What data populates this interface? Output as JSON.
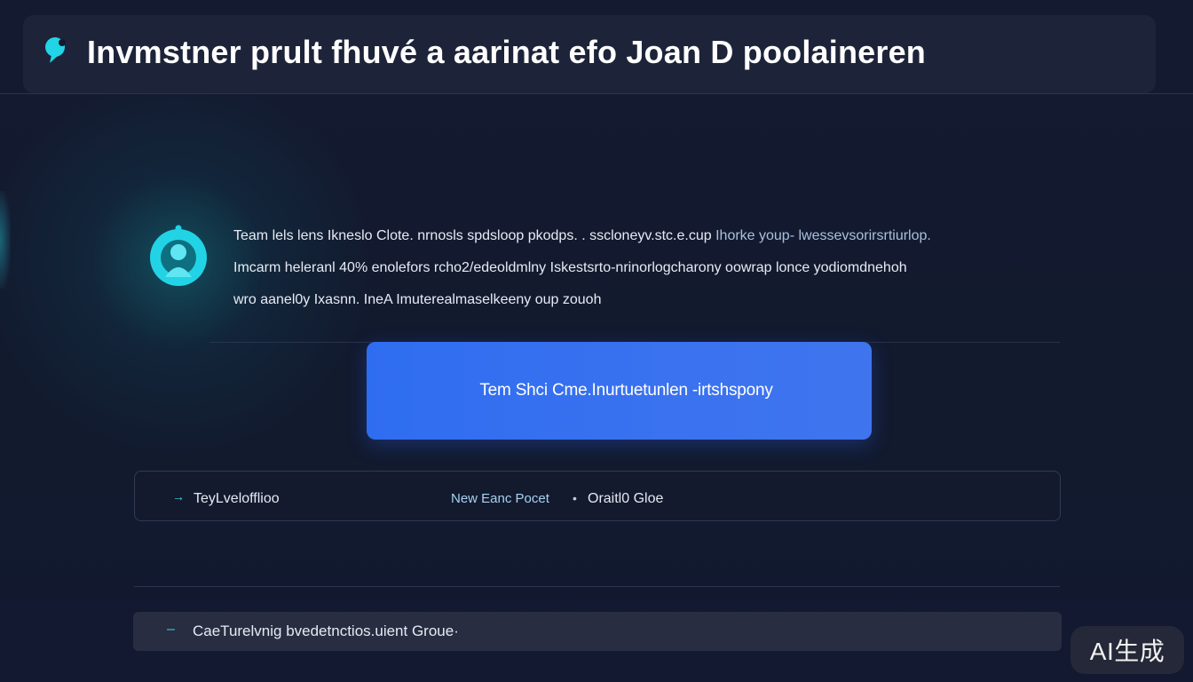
{
  "header": {
    "title": "Invmstner prult fhuvé a aarinat efo Joan D poolaineren"
  },
  "description": {
    "line1_main": "Team lels lens Ikneslo Clote. nrnosls spdsloop pkodps.  . sscloneyv.stc.e.cup",
    "line1_muted": "Ihorke youp- lwessevsorirsrtiurlop.",
    "line2": "Imcarm heleranl 40% enolefors rcho2/edeoldmlny Iskestsrto-nrinorlogcharony oowrap lonce yodiomdnehoh",
    "line3": "wro aanel0y Ixasnn. IneA Imuterealmaselkeeny oup zouoh"
  },
  "cta": {
    "label": "Tem Shci Cme.Inurtuetunlen -irtshspony"
  },
  "info_row": {
    "arrow": "→",
    "label": "TeyLvelofflioo",
    "meta": "New Eanc Pocet",
    "separator": "•",
    "value": "Oraitl0 Gloe"
  },
  "bottom_bar": {
    "dash": "–",
    "label": "CaeTurelvnig bvedetnctios.uient Groue·"
  },
  "watermark": {
    "text": "AI生成"
  },
  "icons": {
    "header_icon": "chat-bubble-icon",
    "feature_icon": "user-bell-icon"
  },
  "colors": {
    "accent_cyan": "#22d3e6",
    "primary_blue": "#3a72ef",
    "background": "#131a2e"
  }
}
